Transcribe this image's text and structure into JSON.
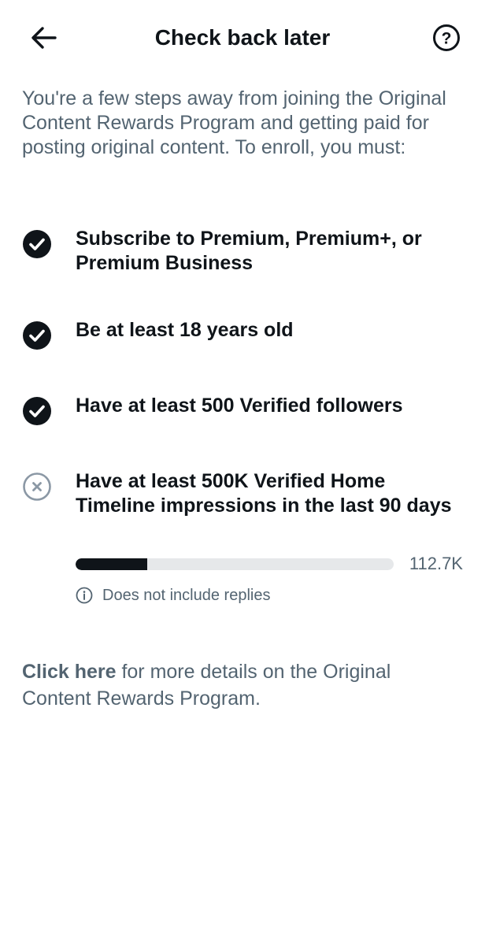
{
  "header": {
    "title": "Check back later",
    "back_icon": "arrow-left-icon",
    "help_icon": "question-circle-icon"
  },
  "intro": "You're a few steps away from joining the Original Content Rewards Program and getting paid for posting original content. To enroll, you must:",
  "requirements": [
    {
      "label": "Subscribe to Premium, Premium+, or Premium Business",
      "status": "met",
      "icon": "check-circle-icon"
    },
    {
      "label": "Be at least 18 years old",
      "status": "met",
      "icon": "check-circle-icon"
    },
    {
      "label": "Have at least 500 Verified followers",
      "status": "met",
      "icon": "check-circle-icon"
    },
    {
      "label": "Have at least 500K Verified Home Timeline impressions in the last 90 days",
      "status": "not-met",
      "icon": "x-circle-icon"
    }
  ],
  "progress": {
    "value_label": "112.7K",
    "current": 112.7,
    "target": 500,
    "note": "Does not include replies",
    "note_icon": "info-icon"
  },
  "footer": {
    "link_text": "Click here",
    "rest_text": " for more details on the Original Content Rewards Program."
  },
  "colors": {
    "text_primary": "#0f1419",
    "text_secondary": "#536471",
    "check_fill": "#0f1419",
    "x_circle": "#8b98a5",
    "track": "#e6e8ea"
  }
}
